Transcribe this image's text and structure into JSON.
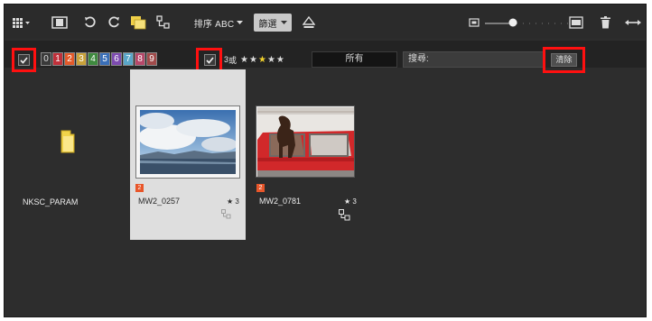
{
  "toolbar": {
    "sort_label": "排序 ABC",
    "filter_label": "篩選"
  },
  "filterbar": {
    "color_labels": [
      {
        "text": "0",
        "bg": "#3a3a3a",
        "fg": "#dddddd"
      },
      {
        "text": "1",
        "bg": "#c0303a",
        "fg": "#ffffff"
      },
      {
        "text": "2",
        "bg": "#e35a2a",
        "fg": "#ffffff"
      },
      {
        "text": "3",
        "bg": "#c9a23a",
        "fg": "#ffffff"
      },
      {
        "text": "4",
        "bg": "#3f8a3f",
        "fg": "#ffffff"
      },
      {
        "text": "5",
        "bg": "#3a6fb8",
        "fg": "#ffffff"
      },
      {
        "text": "6",
        "bg": "#7d4bb0",
        "fg": "#ffffff"
      },
      {
        "text": "7",
        "bg": "#5aa6c8",
        "fg": "#ffffff"
      },
      {
        "text": "8",
        "bg": "#b7486a",
        "fg": "#ffffff"
      },
      {
        "text": "9",
        "bg": "#a04a4a",
        "fg": "#ffffff"
      }
    ],
    "rating_prefix": "3 ",
    "rating_op": "或",
    "rating_stars": 5,
    "rating_selected": 3,
    "all_label": "所有",
    "search_label": "搜尋:",
    "clear_label": "清除"
  },
  "items": [
    {
      "name": "NKSC_PARAM",
      "type": "folder"
    },
    {
      "name": "MW2_0257",
      "badge": "2",
      "count": "★ 3",
      "selected": true
    },
    {
      "name": "MW2_0781",
      "badge": "2",
      "count": "★ 3",
      "selected": false
    }
  ],
  "colors": {
    "app_bg": "#2d2d2d",
    "toolbar_bg": "#2b2b2b",
    "selected_tile": "#dedede",
    "highlight": "#ff1010",
    "badge": "#e8562a"
  }
}
